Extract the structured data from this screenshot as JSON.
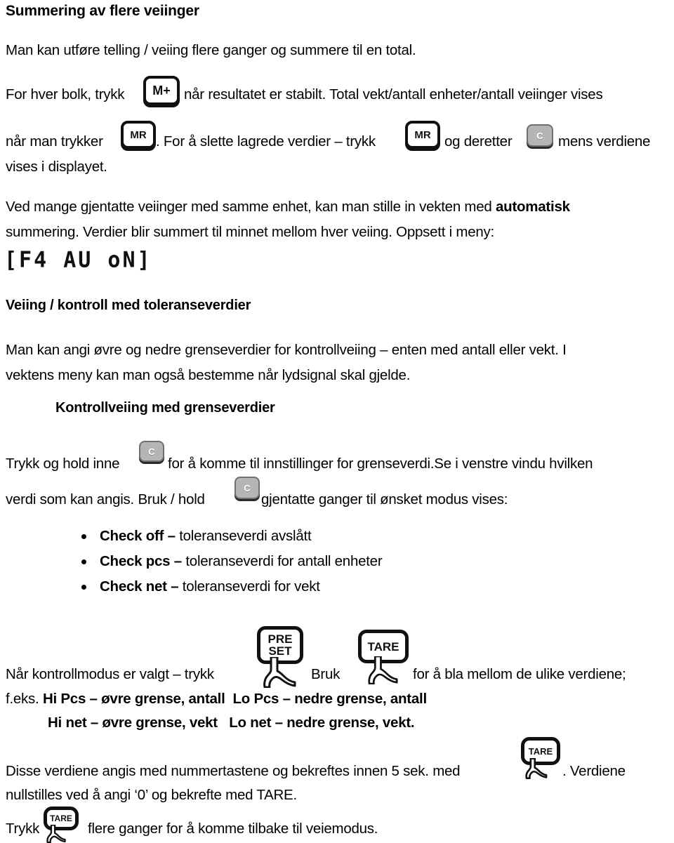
{
  "document": {
    "language": "Norwegian",
    "heading": "Summering av flere veiinger",
    "intro": "Man kan utføre telling / veiing flere ganger og summere til en total.",
    "p1_a": "For hver bolk, trykk",
    "p1_b": "når resultatet er stabilt. Total vekt/antall enheter/antall veiinger vises",
    "p2_a": "når man trykker",
    "p2_b": ". For å slette lagrede verdier – trykk",
    "p2_c": "og deretter",
    "p2_d": "mens verdiene",
    "p3": "vises i displayet.",
    "p4_a": "Ved mange gjentatte veiinger med samme enhet, kan man stille in vekten med ",
    "p4_bold": "automatisk",
    "p5": "summering. Verdier blir summert til minnet mellom hver veiing. Oppsett i meny:",
    "lcd_line": "[F4  AU  oN]",
    "heading2": "Veiing / kontroll med toleranseverdier",
    "p6": "Man kan angi øvre og nedre grenseverdier for kontrollveiing – enten med antall eller vekt. I",
    "p7": "vektens meny kan man også bestemme når lydsignal skal gjelde.",
    "heading3": "Kontrollveiing med grenseverdier",
    "p8_a": "Trykk og hold inne",
    "p8_b": "for å komme til innstillinger for grenseverdi.Se i venstre vindu hvilken",
    "p9_a": "verdi som kan angis. Bruk / hold",
    "p9_b": "gjentatte ganger til ønsket modus vises:",
    "bullets": [
      {
        "lead": "Check off –",
        "rest": " toleranseverdi avslått"
      },
      {
        "lead": "Check pcs –",
        "rest": " toleranseverdi for antall enheter"
      },
      {
        "lead": "Check net –",
        "rest": " toleranseverdi for vekt"
      }
    ],
    "p10_a": "Når kontrollmodus er valgt – trykk",
    "p10_b": "Bruk",
    "p10_c": "for å bla mellom de ulike verdiene;",
    "p11_plain": "f.eks. ",
    "p11_bold1": "Hi Pcs – øvre grense, antall",
    "p11_bold2": "Lo Pcs – nedre grense, antall",
    "p12_bold1": "Hi net – øvre grense, vekt",
    "p12_bold2": "Lo net – nedre grense, vekt.",
    "p13_a": "Disse verdiene angis med nummertastene og bekreftes innen 5 sek. med",
    "p13_b": ". Verdiene",
    "p14": "nullstilles ved å angi ‘0’ og bekrefte med TARE.",
    "p15_a": "Trykk",
    "p15_b": "flere ganger for å komme tilbake til veiemodus."
  },
  "keys": {
    "m_plus": "M+",
    "mr": "MR",
    "c": "C",
    "preset_line1": "PRE",
    "preset_line2": "SET",
    "tare": "TARE"
  },
  "colors": {
    "text": "#000000",
    "page_background": "#ffffff",
    "key_outline": "#111111",
    "key_gray_face": "#b5b5b5",
    "key_gray_label": "#ffffff"
  }
}
